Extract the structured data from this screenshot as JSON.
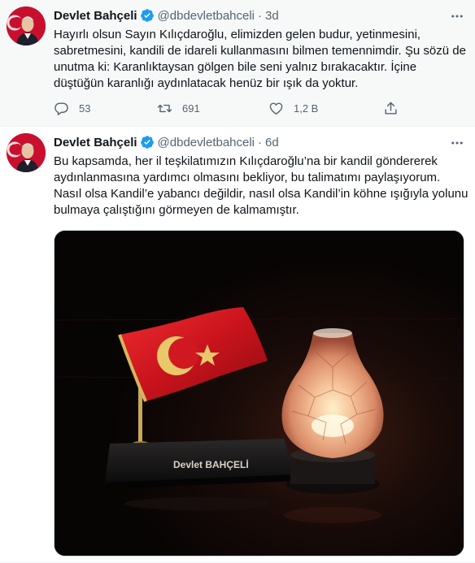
{
  "tweets": [
    {
      "author_name": "Devlet Bahçeli",
      "handle": "@dbdevletbahceli",
      "separator": "·",
      "time": "3d",
      "text_lines": [
        "Hayırlı olsun Sayın Kılıçdaroğlu, elimizden gelen budur, yetinmesini,",
        "sabretmesini, kandili de idareli kullanmasını bilmen temennimdir. Şu sözü de",
        "unutma ki: Karanlıktaysan gölgen bile seni yalnız bırakacaktır. İçine",
        "düştüğün karanlığı aydınlatacak henüz bir ışık da yoktur."
      ],
      "replies": "53",
      "retweets": "691",
      "likes": "1,2 B"
    },
    {
      "author_name": "Devlet Bahçeli",
      "handle": "@dbdevletbahceli",
      "separator": "·",
      "time": "6d",
      "text_lines": [
        "Bu kapsamda, her il teşkilatımızın Kılıçdaroğlu’na bir kandil göndererek",
        "aydınlanmasına yardımcı olmasını bekliyor, bu talimatımı paylaşıyorum.",
        "Nasıl olsa Kandil’e yabancı değildir, nasıl olsa Kandil’in köhne ışığıyla yolunu",
        "bulmaya çalıştığını görmeyen de kalmamıştır."
      ],
      "media": {
        "plaque_text": "Devlet BAHÇELİ",
        "flag_color": "#d4131f",
        "lamp_glow_color": "#f3b98e"
      }
    }
  ],
  "icons": {
    "verified": "verified-badge-icon",
    "more": "more-dots-icon",
    "reply": "reply-icon",
    "retweet": "retweet-icon",
    "like": "heart-icon",
    "share": "share-icon"
  },
  "colors": {
    "verified_blue": "#1d9bf0",
    "secondary_text": "#536471",
    "highlight_bg": "#f7f9f9",
    "avatar_red": "#c8102e"
  }
}
